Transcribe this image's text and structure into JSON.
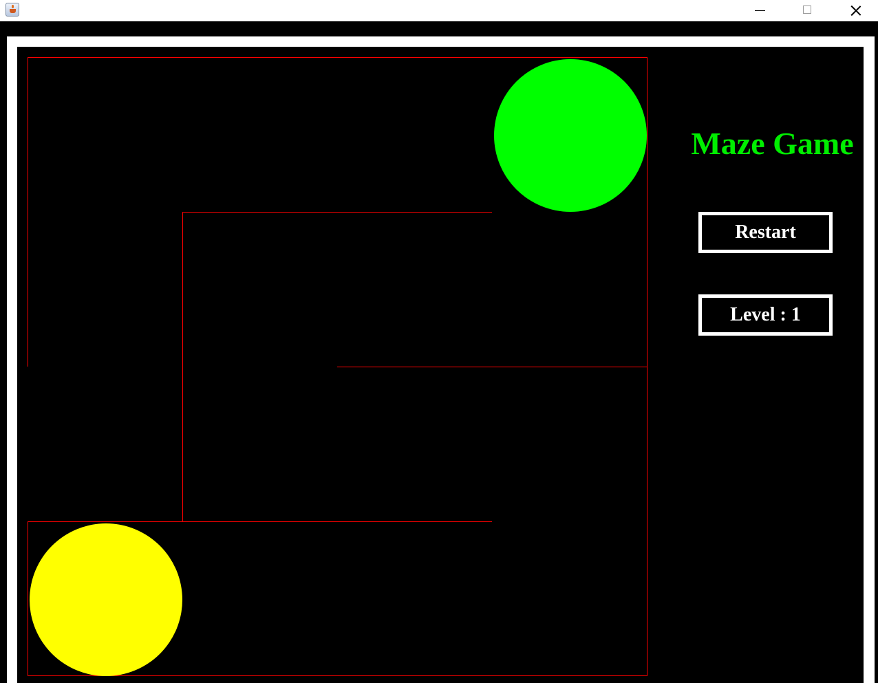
{
  "window": {
    "title": "",
    "controls": {
      "minimize_icon": "minimize-icon",
      "maximize_icon": "maximize-icon",
      "close_icon": "close-icon"
    }
  },
  "colors": {
    "background": "#000000",
    "wall": "#ff0000",
    "goal": "#00ff00",
    "player": "#ffff00",
    "title": "#00ee00",
    "panel_text": "#ffffff"
  },
  "side_panel": {
    "title": "Maze Game",
    "restart_label": "Restart",
    "level_label": "Level : 1"
  }
}
